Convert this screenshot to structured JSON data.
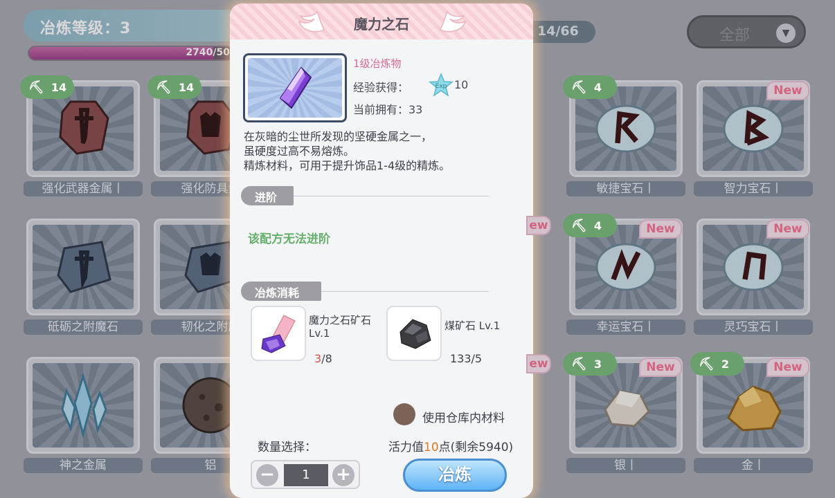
{
  "header": {
    "level_label": "冶炼等级：3",
    "xp_text": "2740/50",
    "xp_fraction": 0.9,
    "count_text": "14/66",
    "filter_label": "全部"
  },
  "grid": {
    "items": [
      {
        "name": "强化武器金属丨",
        "pick": "14",
        "new": "",
        "icon": "sword-ingot"
      },
      {
        "name": "强化防具金",
        "pick": "14",
        "new": "",
        "icon": "armor-ingot"
      },
      {
        "name": "敏捷宝石丨",
        "pick": "4",
        "new": "",
        "icon": "rune-r"
      },
      {
        "name": "智力宝石丨",
        "pick": "",
        "new": "New",
        "icon": "rune-b"
      },
      {
        "name": "砥砺之附魔石",
        "pick": "",
        "new": "",
        "icon": "sword-slate"
      },
      {
        "name": "韧化之附魔",
        "pick": "",
        "new": "",
        "icon": "armor-slate"
      },
      {
        "name": "幸运宝石丨",
        "pick": "4",
        "new": "New",
        "icon": "rune-n"
      },
      {
        "name": "灵巧宝石丨",
        "pick": "",
        "new": "New",
        "icon": "rune-u"
      },
      {
        "name": "神之金属",
        "pick": "",
        "new": "",
        "icon": "crystal"
      },
      {
        "name": "铝",
        "pick": "",
        "new": "",
        "icon": "ore-ball"
      },
      {
        "name": "银丨",
        "pick": "3",
        "new": "New",
        "icon": "silver-ore"
      },
      {
        "name": "金丨",
        "pick": "2",
        "new": "New",
        "icon": "gold-ore"
      }
    ],
    "partial_new": "ew"
  },
  "panel": {
    "title": "魔力之石",
    "tier": "1级冶炼物",
    "exp_label": "经验获得：",
    "exp_value": "10",
    "exp_badge": "Exp",
    "own_label": "当前拥有：33",
    "desc_lines": [
      "在灰暗的尘世所发现的坚硬金属之一，",
      "虽硬度过高不易熔炼。",
      "精炼材料，可用于提升饰品1-4级的精炼。"
    ],
    "advance_title": "进阶",
    "advance_msg": "该配方无法进阶",
    "cost_title": "冶炼消耗",
    "materials": [
      {
        "name1": "魔力之石矿石",
        "name2": "Lv.1",
        "have": "3",
        "need": "/8",
        "icon": "magic-ore-icon"
      },
      {
        "name1": "煤矿石 Lv.1",
        "name2": "",
        "have": "",
        "need": "133/5",
        "icon": "coal-ore-icon"
      }
    ],
    "use_storage_label": "使用仓库内材料",
    "qty_label": "数量选择：",
    "vitality_pre": "活力值",
    "vitality_num": "10",
    "vitality_post": "点(剩余5940)",
    "qty_value": "1",
    "minus": "−",
    "plus": "+",
    "smelt_label": "冶炼"
  }
}
